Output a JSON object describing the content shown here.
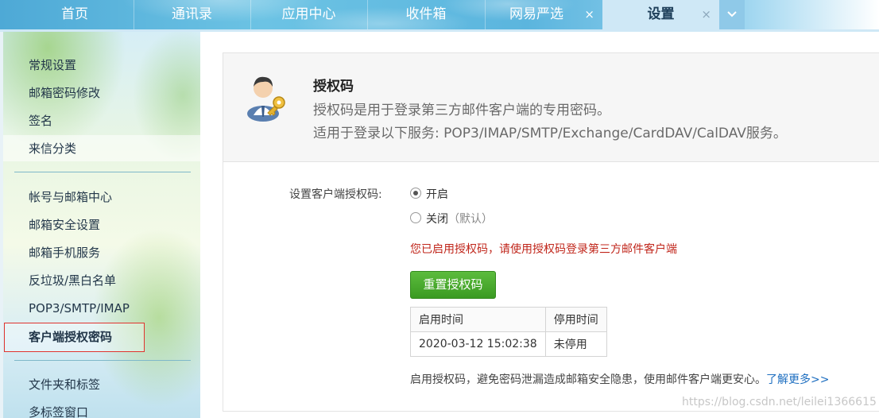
{
  "tabs": [
    {
      "label": "首页",
      "active": false,
      "closable": false
    },
    {
      "label": "通讯录",
      "active": false,
      "closable": false
    },
    {
      "label": "应用中心",
      "active": false,
      "closable": false
    },
    {
      "label": "收件箱",
      "active": false,
      "closable": false
    },
    {
      "label": "网易严选",
      "active": false,
      "closable": true
    },
    {
      "label": "设置",
      "active": true,
      "closable": true
    }
  ],
  "tab_close_glyph": "×",
  "tab_more_icon": "chevron-down-icon",
  "sidebar": {
    "group1": [
      "常规设置",
      "邮箱密码修改",
      "签名",
      "来信分类"
    ],
    "group2": [
      "帐号与邮箱中心",
      "邮箱安全设置",
      "邮箱手机服务",
      "反垃圾/黑白名单",
      "POP3/SMTP/IMAP",
      "客户端授权密码"
    ],
    "group3": [
      "文件夹和标签",
      "多标签窗口"
    ],
    "selected": "客户端授权密码"
  },
  "header": {
    "icon": "user-key-icon",
    "title": "授权码",
    "desc1": "授权码是用于登录第三方邮件客户端的专用密码。",
    "desc2": "适用于登录以下服务: POP3/IMAP/SMTP/Exchange/CardDAV/CalDAV服务。"
  },
  "form": {
    "label": "设置客户端授权码:",
    "option_on": "开启",
    "option_off": "关闭",
    "option_off_hint": "（默认）",
    "selected": "on",
    "warning": "您已启用授权码，请使用授权码登录第三方邮件客户端",
    "reset_button": "重置授权码"
  },
  "table": {
    "headers": [
      "启用时间",
      "停用时间"
    ],
    "rows": [
      [
        "2020-03-12 15:02:38",
        "未停用"
      ]
    ]
  },
  "footer": {
    "text": "启用授权码，避免密码泄漏造成邮箱安全隐患，使用邮件客户端更安心。",
    "link": "了解更多>>"
  },
  "watermark": "https://blog.csdn.net/leilei1366615",
  "colors": {
    "accent": "#4ea9d6",
    "button": "#46a82b",
    "warning": "#c0261b",
    "link": "#1d6ec0"
  }
}
